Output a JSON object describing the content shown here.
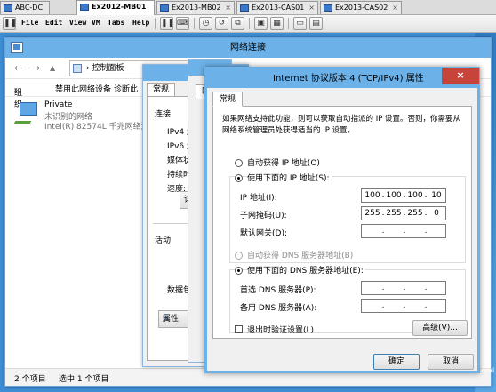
{
  "vm_tabs": [
    {
      "label": "ABC-DC",
      "active": false
    },
    {
      "label": "Ex2012-MB01",
      "active": true
    },
    {
      "label": "Ex2013-MB02",
      "active": false
    },
    {
      "label": "Ex2013-CAS01",
      "active": false
    },
    {
      "label": "Ex2013-CAS02",
      "active": false
    }
  ],
  "vm_menu": {
    "items": [
      "File",
      "Edit",
      "View",
      "VM",
      "Tabs",
      "Help"
    ],
    "toolbar_icons": [
      "pause-icon",
      "send-ctrl-alt-del-icon",
      "snapshot-icon",
      "revert-snapshot-icon",
      "manage-snapshots-icon",
      "fullscreen-icon",
      "unity-icon",
      "console-view-icon",
      "thumbnail-icon"
    ]
  },
  "network_window": {
    "title": "网络连接",
    "breadcrumb": "控制面板",
    "commands": [
      "组织",
      "禁用此网络设备",
      "诊断此"
    ],
    "adapter": {
      "name": "Private",
      "status": "未识别的网络",
      "device": "Intel(R) 82574L 千兆网络连..."
    },
    "status_bar": {
      "items_count": "2 个项目",
      "selected_count": "选中 1 个项目"
    }
  },
  "status_dialog": {
    "tab": "常规",
    "section_connection": "连接",
    "rows": [
      "IPv4 连",
      "IPv6 连",
      "媒体状",
      "持续时",
      "速度:"
    ],
    "details_button": "详",
    "section_activity": "活动",
    "packets_label": "数据包",
    "properties_button": "属性"
  },
  "properties_dialog_tab": "网",
  "ipv4_dialog": {
    "title": "Internet 协议版本 4 (TCP/IPv4) 属性",
    "close_glyph": "×",
    "tab": "常规",
    "description": "如果网络支持此功能，则可以获取自动指派的 IP 设置。否则，你需要从网络系统管理员处获得适当的 IP 设置。",
    "ip_mode": {
      "auto_label": "自动获得 IP 地址(O)",
      "manual_label": "使用下面的 IP 地址(S):",
      "selected": "manual"
    },
    "ip_address": {
      "label": "IP 地址(I):",
      "octets": [
        "100",
        "100",
        "100",
        "10"
      ]
    },
    "subnet_mask": {
      "label": "子网掩码(U):",
      "octets": [
        "255",
        "255",
        "255",
        "0"
      ]
    },
    "default_gateway": {
      "label": "默认网关(D):",
      "octets": [
        "",
        "",
        "",
        ""
      ]
    },
    "dns_mode": {
      "auto_label": "自动获得 DNS 服务器地址(B)",
      "manual_label": "使用下面的 DNS 服务器地址(E):",
      "selected": "manual"
    },
    "preferred_dns": {
      "label": "首选 DNS 服务器(P):",
      "octets": [
        "",
        "",
        "",
        ""
      ]
    },
    "alternate_dns": {
      "label": "备用 DNS 服务器(A):",
      "octets": [
        "",
        "",
        "",
        ""
      ]
    },
    "validate_on_exit": {
      "label": "退出时验证设置(L)",
      "checked": false
    },
    "advanced_button": "高级(V)...",
    "ok_button": "确定",
    "cancel_button": "取消"
  },
  "desktop_edge_text": "ervi",
  "colors": {
    "title_bar": "#6cb1e8",
    "desktop": "#3e8ed6",
    "close_button": "#c7443a"
  }
}
